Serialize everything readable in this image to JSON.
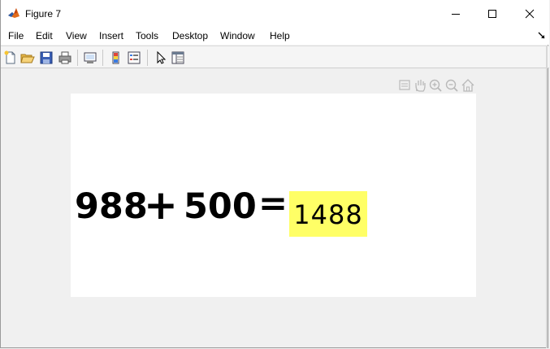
{
  "window": {
    "title": "Figure 7"
  },
  "menu": {
    "items": [
      "File",
      "Edit",
      "View",
      "Insert",
      "Tools",
      "Desktop",
      "Window",
      "Help"
    ]
  },
  "toolbar": {
    "buttons": [
      "new-figure-icon",
      "open-file-icon",
      "save-figure-icon",
      "print-figure-icon",
      "link-plot-icon",
      "insert-colorbar-icon",
      "insert-legend-icon",
      "edit-plot-icon",
      "property-inspector-icon"
    ]
  },
  "axes_toolbar": {
    "buttons": [
      "data-tips-icon",
      "pan-icon",
      "zoom-in-icon",
      "zoom-out-icon",
      "restore-view-icon"
    ]
  },
  "figure": {
    "operand1": "988",
    "operator": "+",
    "operand2": "500",
    "equals": "=",
    "result": "1488",
    "result_background": "#ffff66"
  },
  "colors": {
    "titlebar": "#ffffff",
    "figure_background": "#f0f0f0",
    "axes_background": "#ffffff",
    "matlab_orange": "#e16b1c",
    "matlab_blue": "#2a5ba8"
  }
}
